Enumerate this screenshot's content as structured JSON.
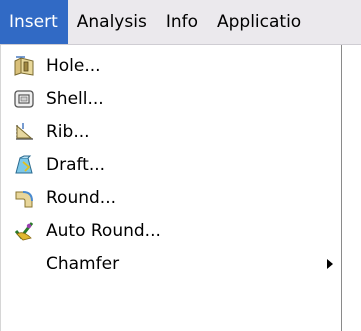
{
  "menubar": {
    "items": [
      {
        "label": "Insert",
        "active": true
      },
      {
        "label": "Analysis"
      },
      {
        "label": "Info"
      },
      {
        "label": "Applicatio"
      }
    ]
  },
  "insert_menu": {
    "items": [
      {
        "label": "Hole...",
        "icon": "hole-icon"
      },
      {
        "label": "Shell...",
        "icon": "shell-icon"
      },
      {
        "label": "Rib...",
        "icon": "rib-icon"
      },
      {
        "label": "Draft...",
        "icon": "draft-icon"
      },
      {
        "label": "Round...",
        "icon": "round-icon"
      },
      {
        "label": "Auto Round...",
        "icon": "auto-round-icon"
      },
      {
        "label": "Chamfer",
        "submenu": true
      }
    ]
  },
  "colors": {
    "highlight": "#316ac5",
    "menubar_bg": "#ebe9ed"
  }
}
